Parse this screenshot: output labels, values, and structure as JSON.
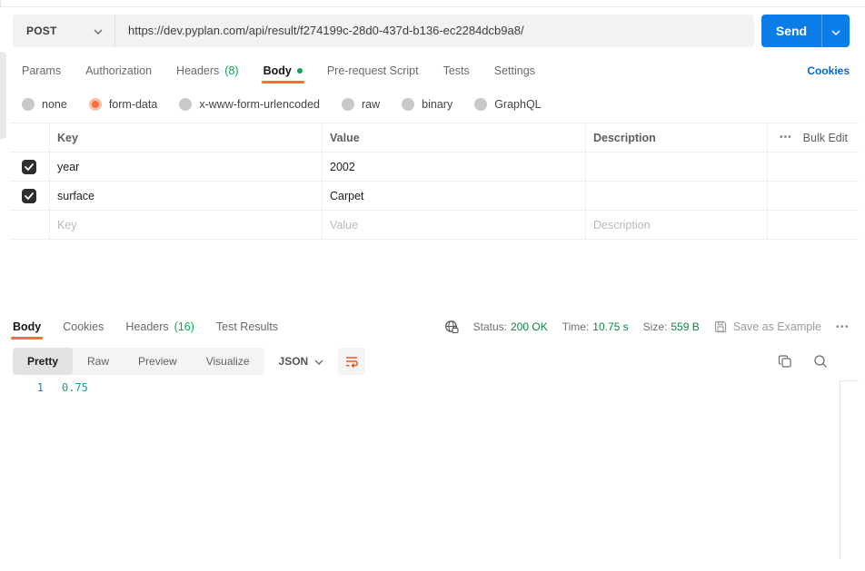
{
  "colors": {
    "accent_orange": "#ff6c37",
    "send_blue": "#0b7de8",
    "link_blue": "#0265d2",
    "count_green": "#0ca454",
    "status_green": "#0e8345",
    "code_teal": "#0fa3a3",
    "line_number_blue": "#3e6fbb"
  },
  "request": {
    "method": "POST",
    "url": "https://dev.pyplan.com/api/result/f274199c-28d0-437d-b136-ec2284dcb9a8/",
    "send_label": "Send",
    "cookies_link": "Cookies",
    "tabs": [
      {
        "label": "Params"
      },
      {
        "label": "Authorization"
      },
      {
        "label": "Headers",
        "count": "(8)"
      },
      {
        "label": "Body"
      },
      {
        "label": "Pre-request Script"
      },
      {
        "label": "Tests"
      },
      {
        "label": "Settings"
      }
    ],
    "body_modes": {
      "selected": "form-data",
      "options": [
        "none",
        "form-data",
        "x-www-form-urlencoded",
        "raw",
        "binary",
        "GraphQL"
      ]
    },
    "params_table": {
      "headers": {
        "key": "Key",
        "value": "Value",
        "description": "Description"
      },
      "more_icon": "•••",
      "bulk_edit_label": "Bulk Edit",
      "rows": [
        {
          "key": "year",
          "value": "2002",
          "description": ""
        },
        {
          "key": "surface",
          "value": "Carpet",
          "description": ""
        }
      ],
      "new_row_placeholders": {
        "key": "Key",
        "value": "Value",
        "description": "Description"
      }
    }
  },
  "response": {
    "tabs": [
      {
        "label": "Body"
      },
      {
        "label": "Cookies"
      },
      {
        "label": "Headers",
        "count": "(16)"
      },
      {
        "label": "Test Results"
      }
    ],
    "status": {
      "label": "Status:",
      "value": "200 OK"
    },
    "time": {
      "label": "Time:",
      "value": "10.75 s"
    },
    "size": {
      "label": "Size:",
      "value": "559 B"
    },
    "save_as_example_label": "Save as Example",
    "more_icon": "•••",
    "view_tabs": [
      "Pretty",
      "Raw",
      "Preview",
      "Visualize"
    ],
    "active_view_tab": "Pretty",
    "format_select": "JSON",
    "body": {
      "line_number": "1",
      "content": "0.75"
    }
  }
}
